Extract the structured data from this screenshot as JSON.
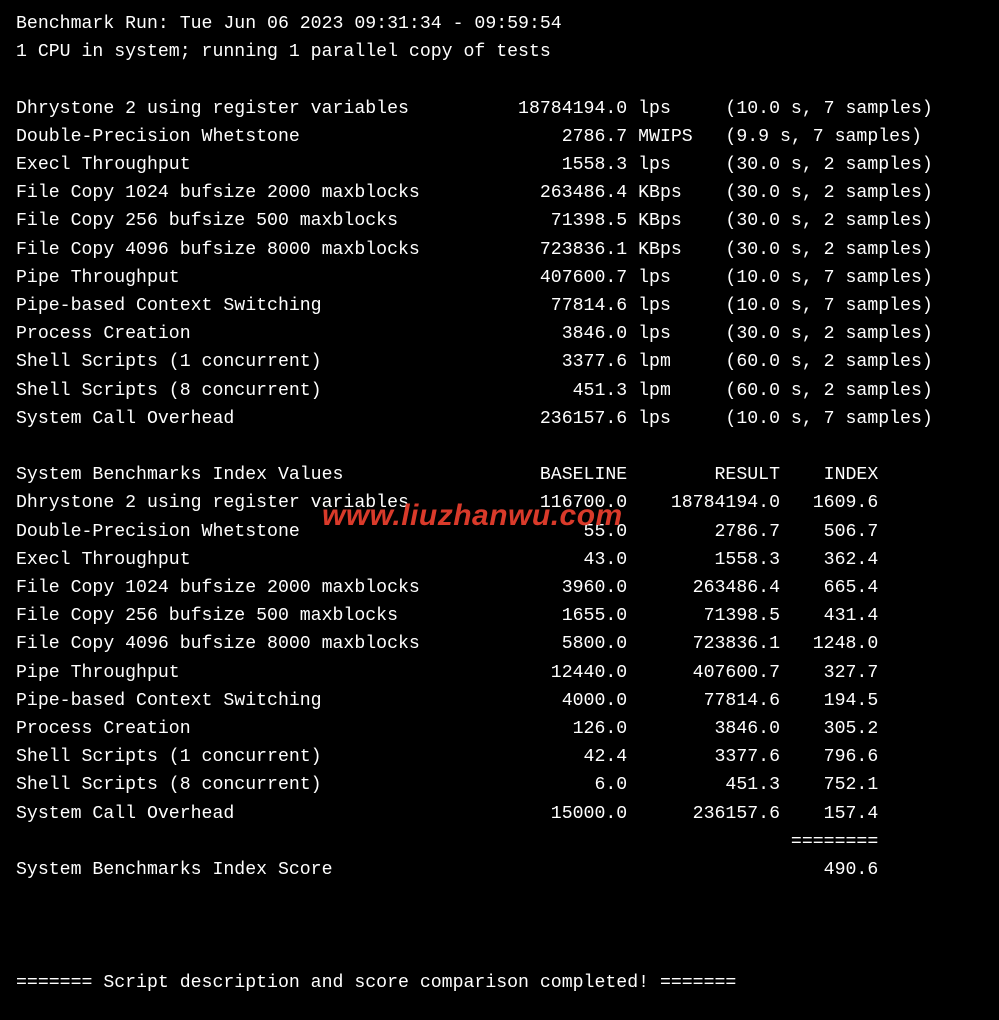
{
  "header": {
    "run_line": "Benchmark Run: Tue Jun 06 2023 09:31:34 - 09:59:54",
    "cpu_line": "1 CPU in system; running 1 parallel copy of tests"
  },
  "results": [
    {
      "name": "Dhrystone 2 using register variables",
      "value": "18784194.0",
      "unit": "lps",
      "time": "10.0",
      "samples": "7"
    },
    {
      "name": "Double-Precision Whetstone",
      "value": "2786.7",
      "unit": "MWIPS",
      "time": "9.9",
      "samples": "7"
    },
    {
      "name": "Execl Throughput",
      "value": "1558.3",
      "unit": "lps",
      "time": "30.0",
      "samples": "2"
    },
    {
      "name": "File Copy 1024 bufsize 2000 maxblocks",
      "value": "263486.4",
      "unit": "KBps",
      "time": "30.0",
      "samples": "2"
    },
    {
      "name": "File Copy 256 bufsize 500 maxblocks",
      "value": "71398.5",
      "unit": "KBps",
      "time": "30.0",
      "samples": "2"
    },
    {
      "name": "File Copy 4096 bufsize 8000 maxblocks",
      "value": "723836.1",
      "unit": "KBps",
      "time": "30.0",
      "samples": "2"
    },
    {
      "name": "Pipe Throughput",
      "value": "407600.7",
      "unit": "lps",
      "time": "10.0",
      "samples": "7"
    },
    {
      "name": "Pipe-based Context Switching",
      "value": "77814.6",
      "unit": "lps",
      "time": "10.0",
      "samples": "7"
    },
    {
      "name": "Process Creation",
      "value": "3846.0",
      "unit": "lps",
      "time": "30.0",
      "samples": "2"
    },
    {
      "name": "Shell Scripts (1 concurrent)",
      "value": "3377.6",
      "unit": "lpm",
      "time": "60.0",
      "samples": "2"
    },
    {
      "name": "Shell Scripts (8 concurrent)",
      "value": "451.3",
      "unit": "lpm",
      "time": "60.0",
      "samples": "2"
    },
    {
      "name": "System Call Overhead",
      "value": "236157.6",
      "unit": "lps",
      "time": "10.0",
      "samples": "7"
    }
  ],
  "index_header": {
    "title": "System Benchmarks Index Values",
    "col_baseline": "BASELINE",
    "col_result": "RESULT",
    "col_index": "INDEX"
  },
  "index_rows": [
    {
      "name": "Dhrystone 2 using register variables",
      "baseline": "116700.0",
      "result": "18784194.0",
      "index": "1609.6"
    },
    {
      "name": "Double-Precision Whetstone",
      "baseline": "55.0",
      "result": "2786.7",
      "index": "506.7"
    },
    {
      "name": "Execl Throughput",
      "baseline": "43.0",
      "result": "1558.3",
      "index": "362.4"
    },
    {
      "name": "File Copy 1024 bufsize 2000 maxblocks",
      "baseline": "3960.0",
      "result": "263486.4",
      "index": "665.4"
    },
    {
      "name": "File Copy 256 bufsize 500 maxblocks",
      "baseline": "1655.0",
      "result": "71398.5",
      "index": "431.4"
    },
    {
      "name": "File Copy 4096 bufsize 8000 maxblocks",
      "baseline": "5800.0",
      "result": "723836.1",
      "index": "1248.0"
    },
    {
      "name": "Pipe Throughput",
      "baseline": "12440.0",
      "result": "407600.7",
      "index": "327.7"
    },
    {
      "name": "Pipe-based Context Switching",
      "baseline": "4000.0",
      "result": "77814.6",
      "index": "194.5"
    },
    {
      "name": "Process Creation",
      "baseline": "126.0",
      "result": "3846.0",
      "index": "305.2"
    },
    {
      "name": "Shell Scripts (1 concurrent)",
      "baseline": "42.4",
      "result": "3377.6",
      "index": "796.6"
    },
    {
      "name": "Shell Scripts (8 concurrent)",
      "baseline": "6.0",
      "result": "451.3",
      "index": "752.1"
    },
    {
      "name": "System Call Overhead",
      "baseline": "15000.0",
      "result": "236157.6",
      "index": "157.4"
    }
  ],
  "separator": "========",
  "score_label": "System Benchmarks Index Score",
  "score_value": "490.6",
  "footer": "======= Script description and score comparison completed! =======",
  "watermark": "www.liuzhanwu.com"
}
